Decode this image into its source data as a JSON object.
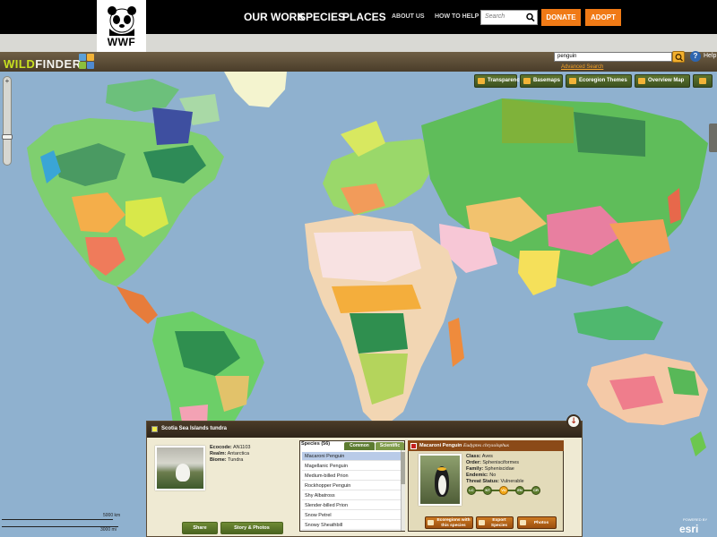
{
  "header": {
    "logo_text": "WWF",
    "nav_main": [
      "OUR WORK",
      "SPECIES",
      "PLACES"
    ],
    "nav_secondary": [
      "ABOUT US",
      "HOW TO HELP"
    ],
    "search_placeholder": "Search",
    "donate_label": "DONATE",
    "adopt_label": "ADOPT"
  },
  "wildfinder": {
    "title_accent": "WILD",
    "title_rest": "FINDER",
    "search_value": "penguin",
    "advanced_search": "Advanced Search",
    "help_label": "Help"
  },
  "toolbar": {
    "transparency": "Transparency",
    "basemaps": "Basemaps",
    "ecoregion_themes": "Ecoregion Themes",
    "overview_map": "Overview Map"
  },
  "scale": {
    "top": "5000 km",
    "bottom": "3000 mi"
  },
  "esri": {
    "powered_by": "POWERED BY",
    "name": "esri"
  },
  "ecoregion": {
    "title": "Scotia Sea Islands tundra",
    "ecocode_label": "Ecocode:",
    "ecocode": "AN1103",
    "realm_label": "Realm:",
    "realm": "Antarctica",
    "biome_label": "Biome:",
    "biome": "Tundra",
    "share_label": "Share",
    "story_label": "Story & Photos"
  },
  "species": {
    "header": "Species (56)",
    "tab_common": "Common",
    "tab_scientific": "Scientific",
    "items": [
      "Macaroni Penguin",
      "Magellanic Penguin",
      "Medium-billed Prion",
      "Rockhopper Penguin",
      "Shy Albatross",
      "Slender-billed Prion",
      "Snow Petrel",
      "Snowy Sheathbill"
    ],
    "selected": "Macaroni Penguin"
  },
  "detail": {
    "name": "Macaroni Penguin",
    "scientific": "Eudyptes chrysolophus",
    "class_label": "Class:",
    "class": "Aves",
    "order_label": "Order:",
    "order": "Sphenisciformes",
    "family_label": "Family:",
    "family": "Spheniscidae",
    "endemic_label": "Endemic:",
    "endemic": "No",
    "threat_label": "Threat Status:",
    "threat": "Vulnerable",
    "threat_scale": [
      "LC",
      "NT",
      "VU",
      "EN",
      "CR"
    ],
    "threat_active_index": 2,
    "btn_ecoregions_1": "Ecoregions with",
    "btn_ecoregions_2": "this species",
    "btn_export_1": "Export",
    "btn_export_2": "Species",
    "btn_photos": "Photos"
  },
  "colors": {
    "orange_button": "#f07a16",
    "wildfinder_green": "#c8e020",
    "ocean": "#8fb1cf",
    "panel_header": "#4a3b28"
  }
}
